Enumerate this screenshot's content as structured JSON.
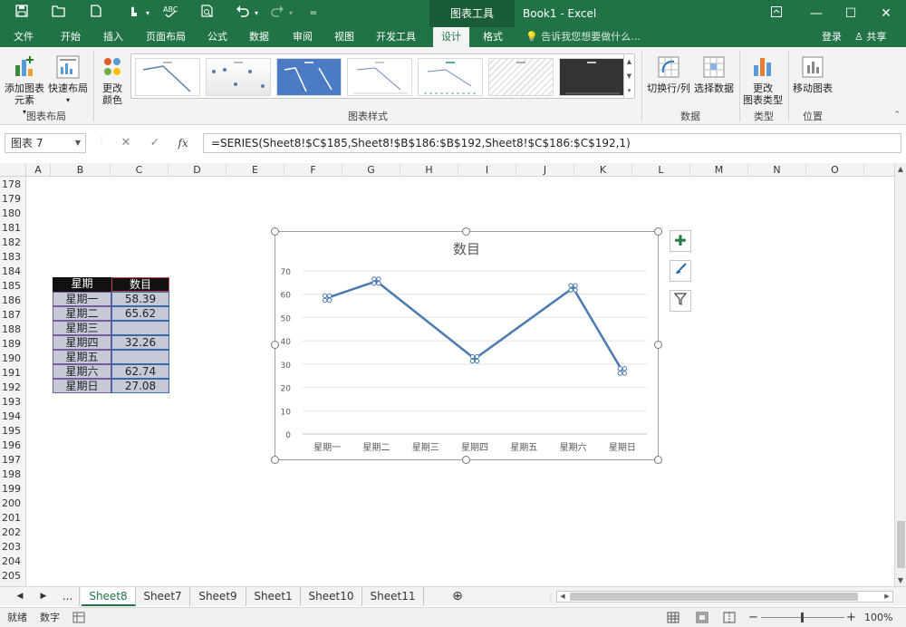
{
  "title_bar": {
    "context_tab": "图表工具",
    "app_title": "Book1 - Excel"
  },
  "ribbon_tabs": [
    "文件",
    "开始",
    "插入",
    "页面布局",
    "公式",
    "数据",
    "审阅",
    "视图",
    "开发工具",
    "设计",
    "格式"
  ],
  "active_tab": "设计",
  "tell_me": "告诉我您想要做什么...",
  "sign_in": "登录",
  "share": "共享",
  "ribbon": {
    "add_chart_element": "添加图表\n元素",
    "quick_layout": "快速布局",
    "change_colors": "更改\n颜色",
    "switch_row_col": "切换行/列",
    "select_data": "选择数据",
    "change_chart_type": "更改\n图表类型",
    "move_chart": "移动图表",
    "group_layouts": "图表布局",
    "group_styles": "图表样式",
    "group_data": "数据",
    "group_type": "类型",
    "group_location": "位置"
  },
  "name_box": "图表 7",
  "fx_label": "fx",
  "formula": "=SERIES(Sheet8!$C$185,Sheet8!$B$186:$B$192,Sheet8!$C$186:$C$192,1)",
  "columns": [
    "A",
    "B",
    "C",
    "D",
    "E",
    "F",
    "G",
    "H",
    "I",
    "J",
    "K",
    "L",
    "M",
    "N",
    "O"
  ],
  "rows": [
    "178",
    "179",
    "180",
    "181",
    "182",
    "183",
    "184",
    "185",
    "186",
    "187",
    "188",
    "189",
    "190",
    "191",
    "192",
    "193",
    "194",
    "195",
    "196",
    "197",
    "198",
    "199",
    "200",
    "201",
    "202",
    "203",
    "204",
    "205"
  ],
  "table": {
    "header_b": "星期",
    "header_c": "数目",
    "rows": [
      {
        "day": "星期一",
        "value": "58.39"
      },
      {
        "day": "星期二",
        "value": "65.62"
      },
      {
        "day": "星期三",
        "value": ""
      },
      {
        "day": "星期四",
        "value": "32.26"
      },
      {
        "day": "星期五",
        "value": ""
      },
      {
        "day": "星期六",
        "value": "62.74"
      },
      {
        "day": "星期日",
        "value": "27.08"
      }
    ]
  },
  "chart_data": {
    "type": "line",
    "title": "数目",
    "categories": [
      "星期一",
      "星期二",
      "星期三",
      "星期四",
      "星期五",
      "星期六",
      "星期日"
    ],
    "series": [
      {
        "values": [
          58.39,
          65.62,
          null,
          32.26,
          null,
          62.74,
          27.08
        ],
        "color": "#4a7ab0"
      }
    ],
    "gap_handling": "connect",
    "xlabel": "",
    "ylabel": "",
    "ylim": [
      0,
      70
    ],
    "yticks": [
      "0",
      "10",
      "20",
      "30",
      "40",
      "50",
      "60",
      "70"
    ],
    "grid": true,
    "legend": "none"
  },
  "chart_side_buttons": [
    "plus-icon",
    "brush-icon",
    "filter-icon"
  ],
  "sheet_tabs": [
    "...",
    "Sheet8",
    "Sheet7",
    "Sheet9",
    "Sheet1",
    "Sheet10",
    "Sheet11"
  ],
  "active_sheet": "Sheet8",
  "status": {
    "ready": "就绪",
    "numlock": "数字",
    "zoom": "100%"
  },
  "colors": {
    "excel_green": "#217346",
    "series_line": "#4a7ab0"
  }
}
